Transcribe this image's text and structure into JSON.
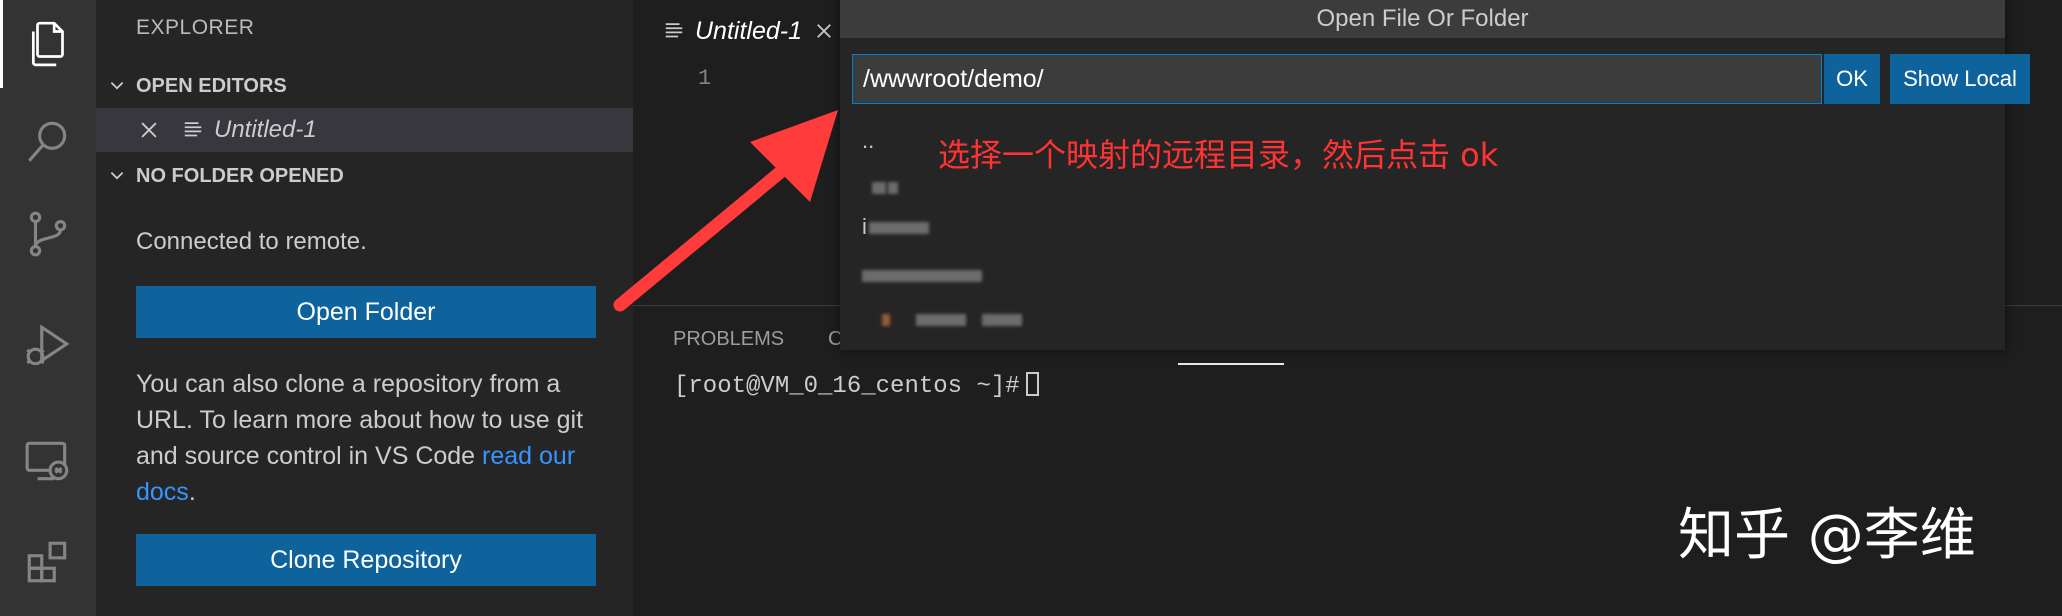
{
  "sidebar": {
    "title": "EXPLORER",
    "open_editors": {
      "header": "OPEN EDITORS",
      "items": [
        {
          "name": "Untitled-1"
        }
      ]
    },
    "no_folder": {
      "header": "NO FOLDER OPENED",
      "connected_text": "Connected to remote.",
      "open_folder_label": "Open Folder",
      "description_1": "You can also clone a repository from a URL. To learn more about how to use git and source control in VS Code ",
      "description_link": "read our docs",
      "description_2": ".",
      "clone_label": "Clone Repository"
    }
  },
  "activity_bar": {
    "items": [
      {
        "icon": "explorer-icon"
      },
      {
        "icon": "search-icon"
      },
      {
        "icon": "source-control-icon"
      },
      {
        "icon": "run-debug-icon"
      },
      {
        "icon": "remote-explorer-icon"
      },
      {
        "icon": "extensions-icon"
      }
    ]
  },
  "editor": {
    "tab_name": "Untitled-1",
    "line_number": "1"
  },
  "panel": {
    "tabs": [
      "PROBLEMS",
      "C"
    ],
    "terminal_prompt": "[root@VM_0_16_centos ~]#"
  },
  "quick_open": {
    "title": "Open File Or Folder",
    "input_value": "/wwwroot/demo/",
    "ok_label": "OK",
    "show_local_label": "Show Local",
    "items": [
      "..",
      "",
      "i",
      "",
      ""
    ]
  },
  "annotation": "选择一个映射的远程目录，然后点击 ok",
  "watermark": "知乎 @李维",
  "colors": {
    "accent": "#0e639c",
    "link": "#3794ff",
    "annotation": "#ff3333"
  }
}
